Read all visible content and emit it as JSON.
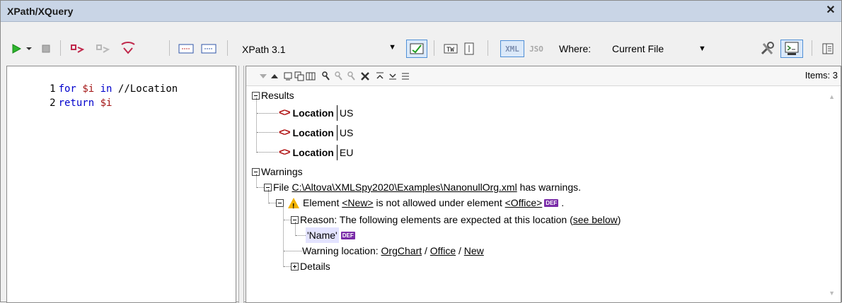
{
  "window": {
    "title": "XPath/XQuery",
    "close_glyph": "✕"
  },
  "toolbar": {
    "xpath_version": "XPath 3.1",
    "xml_label": "XML",
    "json_label": "JSO",
    "where_label": "Where:",
    "where_value": "Current File"
  },
  "editor": {
    "lines": [
      {
        "num": "1",
        "kw": "for",
        "var": "$i",
        "kw2": "in",
        "rest": "//Location"
      },
      {
        "num": "2",
        "kw": "return",
        "var": "$i"
      }
    ]
  },
  "results_toolbar": {
    "items_label": "Items: 3"
  },
  "tree": {
    "results_label": "Results",
    "results": [
      {
        "name": "Location",
        "value": "US"
      },
      {
        "name": "Location",
        "value": "US"
      },
      {
        "name": "Location",
        "value": "EU"
      }
    ],
    "warnings_label": "Warnings",
    "file_prefix": "File",
    "file_path": "C:\\Altova\\XMLSpy2020\\Examples\\NanonullOrg.xml",
    "file_suffix": "has warnings.",
    "element_prefix": "Element",
    "element_new": "<New>",
    "element_mid": "is not allowed under element",
    "element_office": "<Office>",
    "element_suffix": ".",
    "def_badge": "DEF",
    "reason_prefix": "Reason: The following elements are expected at this location (",
    "reason_link": "see below",
    "reason_suffix": ")",
    "name_item": "'Name'",
    "location_prefix": "Warning location:",
    "loc_orgchart": "OrgChart",
    "loc_sep1": "/",
    "loc_office": "Office",
    "loc_sep2": "/",
    "loc_new": "New",
    "details_label": "Details"
  },
  "colors": {
    "titlebar": "#c9d5e6",
    "element_icon": "#b01515",
    "def_badge": "#7a2ca8",
    "warning": "#f2b300"
  }
}
